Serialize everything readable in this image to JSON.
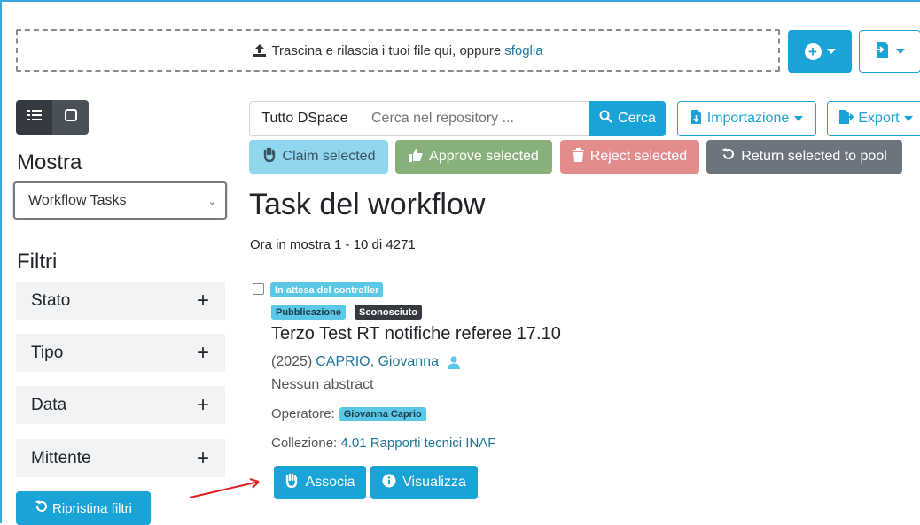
{
  "upload": {
    "text": "Trascina e rilascia i tuoi file qui, oppure",
    "browse_link": "sfoglia"
  },
  "sidebar": {
    "show_label": "Mostra",
    "configuration_select": "Workflow Tasks",
    "filters_label": "Filtri",
    "facets": [
      {
        "label": "Stato"
      },
      {
        "label": "Tipo"
      },
      {
        "label": "Data"
      },
      {
        "label": "Mittente"
      }
    ],
    "reset_label": "Ripristina filtri"
  },
  "search": {
    "scope_label": "Tutto DSpace",
    "placeholder": "Cerca nel repository ...",
    "button_label": "Cerca",
    "import_label": "Importazione",
    "export_label": "Export"
  },
  "bulk_actions": {
    "claim": "Claim selected",
    "approve": "Approve selected",
    "reject": "Reject selected",
    "return": "Return selected to pool"
  },
  "page": {
    "title": "Task del workflow",
    "showing": "Ora in mostra 1 - 10 di 4271"
  },
  "result": {
    "status_badge": "In attesa del controller",
    "type_badge": "Pubblicazione",
    "unknown_badge": "Sconosciuto",
    "title": "Terzo Test RT notifiche referee 17.10",
    "year": "(2025)",
    "author": "CAPRIO, Giovanna",
    "abstract": "Nessun abstract",
    "operator_label": "Operatore:",
    "operator_name": "Giovanna Caprio",
    "collection_label": "Collezione:",
    "collection_name": "4.01 Rapporti tecnici INAF",
    "claim_button": "Associa",
    "view_button": "Visualizza"
  },
  "colors": {
    "primary": "#1aa3d6",
    "claim_disabled": "#8fd6ee",
    "approve": "#88b07a",
    "reject": "#e28c8c",
    "return": "#6c757d",
    "annotation_arrow": "#e02020"
  }
}
